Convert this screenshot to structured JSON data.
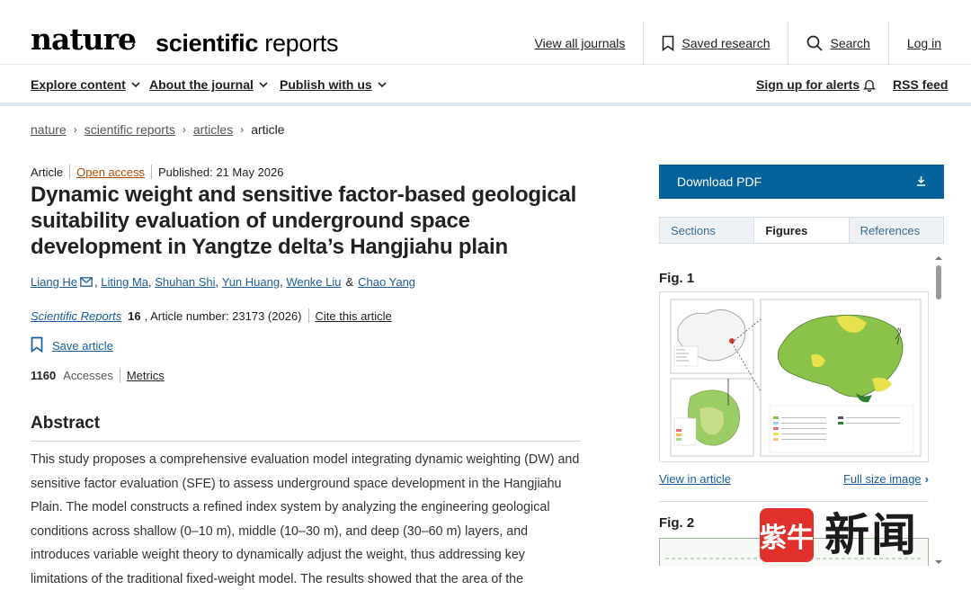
{
  "header": {
    "brand_nature": "nature",
    "brand_arrow": "›",
    "brand_sr_bold": "scientific",
    "brand_sr_light": " reports",
    "links": {
      "journals": "View all journals",
      "saved": "Saved research",
      "search": "Search",
      "login": "Log in"
    }
  },
  "nav": {
    "explore": "Explore content",
    "about": "About the journal",
    "publish": "Publish with us",
    "alerts": "Sign up for alerts",
    "rss": "RSS feed"
  },
  "breadcrumb": [
    "nature",
    "scientific reports",
    "articles",
    "article"
  ],
  "article": {
    "type": "Article",
    "access": "Open access",
    "published": "Published: 21 May 2026",
    "title": "Dynamic weight and sensitive factor-based geological suitability evaluation of underground space development in Yangtze delta’s Hangjiahu plain",
    "authors": [
      "Liang He",
      "Liting Ma",
      "Shuhan Shi",
      "Yun Huang",
      "Wenke Liu",
      "Chao Yang"
    ],
    "author_and": "&",
    "journal": "Scientific Reports",
    "volume": "16",
    "article_number": ", Article number: 23173 (2026)",
    "cite": "Cite this article",
    "save": "Save article",
    "accesses_count": "1160",
    "accesses_label": "Accesses",
    "metrics": "Metrics",
    "abstract_heading": "Abstract",
    "abstract_text": "This study proposes a comprehensive evaluation model integrating dynamic weighting (DW) and sensitive factor evaluation (SFE) to assess underground space development in the Hangjiahu Plain. The model constructs a refined index system by analyzing the engineering geological conditions across shallow (0–10 m), middle (10–30 m), and deep (30–60 m) layers, and introduces variable weight theory to dynamically adjust the weight, thus addressing key limitations of the traditional fixed-weight model. The results showed that the area of the"
  },
  "sidebar": {
    "download": "Download PDF",
    "tabs": [
      "Sections",
      "Figures",
      "References"
    ],
    "active_tab": "Figures",
    "fig1_label": "Fig. 1",
    "fig2_label": "Fig. 2",
    "view_in_article": "View in article",
    "full_size": "Full size image"
  },
  "watermark": {
    "badge": "紫牛",
    "text": "新闻"
  },
  "colors": {
    "accent": "#06629b",
    "link": "#1b5d9c",
    "open_access": "#b04c00",
    "watermark_red": "#e0312c"
  }
}
